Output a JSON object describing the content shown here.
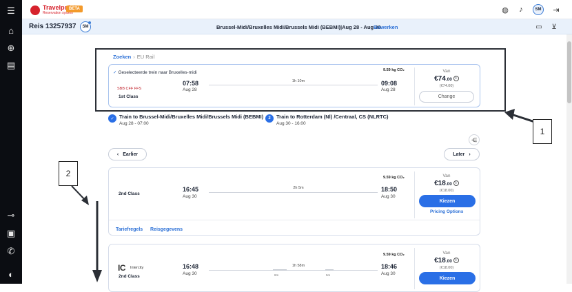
{
  "topbar": {
    "logo_text": "Travelpoint",
    "logo_sub": "Reservation system",
    "beta": "BETA",
    "avatar": "SM"
  },
  "tripbar": {
    "title": "Reis 13257937",
    "avatar": "SM",
    "route": "Brussel-Midi/Bruxelles Midi/Brussels Midi (BEBMI)|Aug 28 - Aug 30",
    "edit": "Bewerken"
  },
  "breadcrumb": {
    "link": "Zoeken",
    "sep": "›",
    "current": "EU Rail"
  },
  "selected": {
    "title": "Geselecteerde trein naar Bruxelles-midi",
    "operator": "SBB CFF FFS",
    "class": "1st Class",
    "dep_time": "07:58",
    "dep_date": "Aug 28",
    "duration": "1h 10m",
    "arr_time": "09:08",
    "arr_date": "Aug 28",
    "co2": "9.59 kg CO₂",
    "van": "Van",
    "price_main": "€74",
    "price_dec": ".00",
    "price_sub": "(€74.00)",
    "change": "Change"
  },
  "steps": [
    {
      "num": "✓",
      "title": "Train to Brussel-Midi/Bruxelles Midi/Brussels Midi (BEBMI)",
      "sub": "Aug 28 - 07:00"
    },
    {
      "num": "2",
      "title": "Train to Rotterdam (Nl) /Centraal, CS (NLRTC)",
      "sub": "Aug 30 - 16:00"
    }
  ],
  "nav": {
    "earlier": "Earlier",
    "later": "Later"
  },
  "results": [
    {
      "class": "2nd Class",
      "dep_time": "16:45",
      "dep_date": "Aug 30",
      "duration": "2h 5m",
      "arr_time": "18:50",
      "arr_date": "Aug 30",
      "co2": "9.59 kg CO₂",
      "van": "Van",
      "price_main": "€18",
      "price_dec": ".00",
      "price_sub": "(€18.00)",
      "choose": "Kiezen",
      "pricing": "Pricing Options",
      "fare_rules": "Tariefregels",
      "travel_data": "Reisgegevens"
    },
    {
      "train_logo": "IC",
      "train_type": "Intercity",
      "class": "2nd Class",
      "dep_time": "16:48",
      "dep_date": "Aug 30",
      "duration": "1h 58m",
      "stop1": "8m",
      "stop2": "5m",
      "arr_time": "18:46",
      "arr_date": "Aug 30",
      "co2": "9.59 kg CO₂",
      "van": "Van",
      "price_main": "€18",
      "price_dec": ".00",
      "price_sub": "(€18.00)",
      "choose": "Kiezen"
    }
  ],
  "callouts": {
    "one": "1",
    "two": "2"
  },
  "icons": {
    "menu": "☰",
    "home": "⌂",
    "add": "⊕",
    "list": "▤",
    "link": "⊸",
    "wallet": "▣",
    "phone": "✆",
    "logo": "◐",
    "globe": "◍",
    "bell": "♪",
    "logout": "⇥",
    "chat": "▭",
    "cart": "⊻",
    "share": "⋲"
  },
  "colors": {
    "accent": "#2a6fe6",
    "brand": "#d6222c",
    "sidebar": "#0b0d12"
  }
}
